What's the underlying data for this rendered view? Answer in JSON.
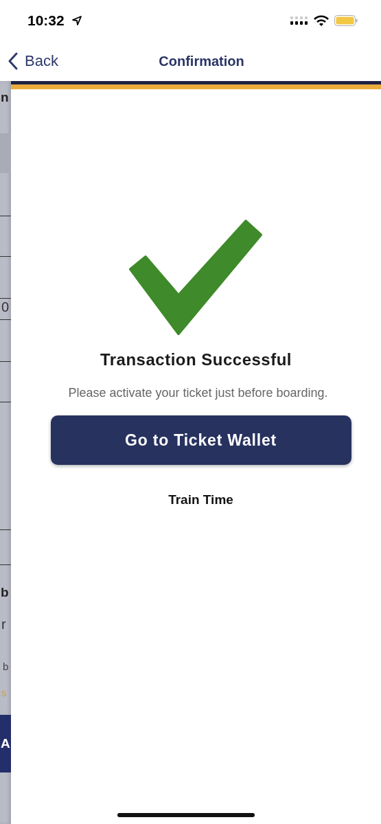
{
  "status_bar": {
    "time": "10:32"
  },
  "nav_bar": {
    "back": "Back",
    "title": "Confirmation"
  },
  "background_page": {
    "fragments": [
      {
        "kind": "heading",
        "text": "n"
      },
      {
        "kind": "value",
        "text": "0"
      },
      {
        "kind": "heading",
        "text": "b"
      },
      {
        "kind": "value",
        "text": "r"
      },
      {
        "kind": "note",
        "text": "b"
      },
      {
        "kind": "link",
        "text": "s"
      },
      {
        "kind": "button",
        "text": "A"
      }
    ]
  },
  "confirmation": {
    "title": "Transaction Successful",
    "message": "Please activate your ticket just before boarding.",
    "button": "Go to Ticket Wallet",
    "link": "Train Time"
  }
}
